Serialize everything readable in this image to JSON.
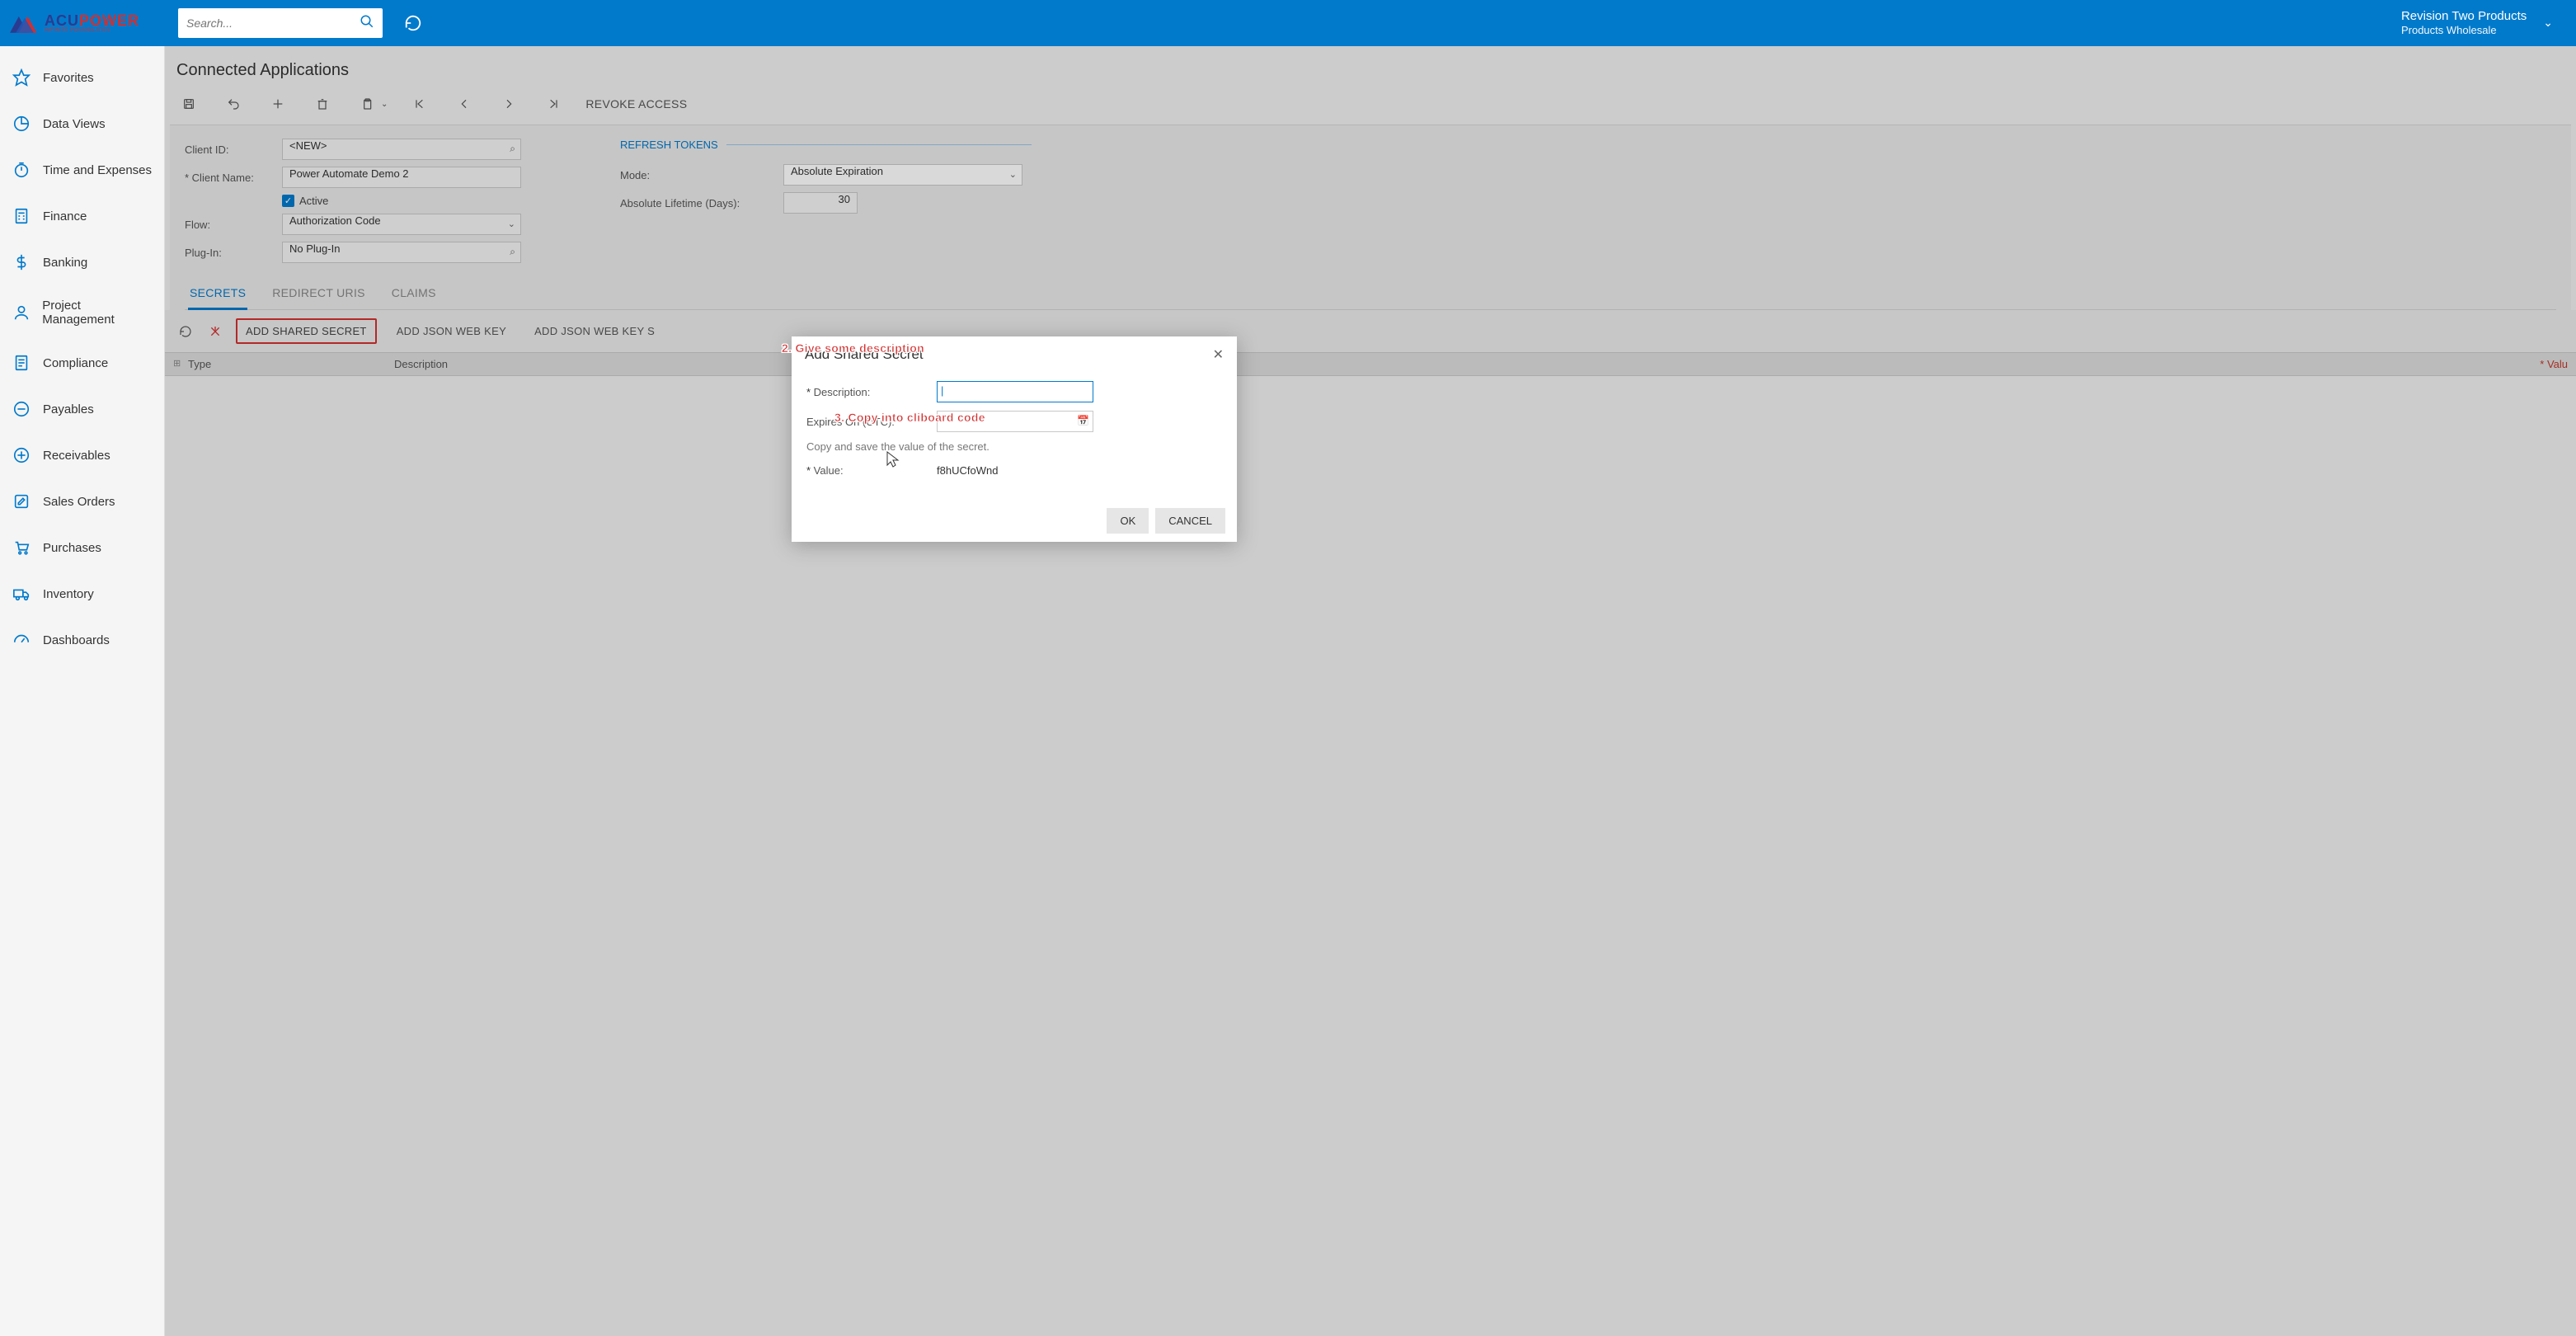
{
  "brand": {
    "name1": "ACU",
    "name2": "POWER",
    "tagline": "INFINITE POSSIBILITIES"
  },
  "search": {
    "placeholder": "Search..."
  },
  "tenant": {
    "title": "Revision Two Products",
    "sub": "Products Wholesale"
  },
  "sidebar": {
    "items": [
      {
        "label": "Favorites"
      },
      {
        "label": "Data Views"
      },
      {
        "label": "Time and Expenses"
      },
      {
        "label": "Finance"
      },
      {
        "label": "Banking"
      },
      {
        "label": "Project Management"
      },
      {
        "label": "Compliance"
      },
      {
        "label": "Payables"
      },
      {
        "label": "Receivables"
      },
      {
        "label": "Sales Orders"
      },
      {
        "label": "Purchases"
      },
      {
        "label": "Inventory"
      },
      {
        "label": "Dashboards"
      }
    ]
  },
  "page": {
    "title": "Connected Applications"
  },
  "toolbar": {
    "revoke": "REVOKE ACCESS"
  },
  "form": {
    "client_id_label": "Client ID:",
    "client_id_value": "<NEW>",
    "client_name_label": "Client Name:",
    "client_name_value": "Power Automate Demo 2",
    "active_label": "Active",
    "flow_label": "Flow:",
    "flow_value": "Authorization Code",
    "plugin_label": "Plug-In:",
    "plugin_value": "No Plug-In",
    "refresh_section": "REFRESH TOKENS",
    "mode_label": "Mode:",
    "mode_value": "Absolute Expiration",
    "lifetime_label": "Absolute Lifetime (Days):",
    "lifetime_value": "30"
  },
  "tabs": {
    "secrets": "SECRETS",
    "redirect": "REDIRECT URIS",
    "claims": "CLAIMS"
  },
  "gridbar": {
    "add_shared": "ADD SHARED SECRET",
    "add_jwk": "ADD JSON WEB KEY",
    "add_jwks": "ADD JSON WEB KEY S"
  },
  "gridhead": {
    "type": "Type",
    "desc": "Description",
    "valu": "Valu"
  },
  "modal": {
    "title": "Add Shared Secret",
    "desc_label": "Description:",
    "expires_label": "Expires On (UTC):",
    "hint": "Copy and save the value of the secret.",
    "value_label": "Value:",
    "value": "f8hUCfoWnd",
    "ok": "OK",
    "cancel": "CANCEL"
  },
  "annotations": {
    "a2": "2. Give some description",
    "a3": "3. Copy into cliboard code"
  }
}
